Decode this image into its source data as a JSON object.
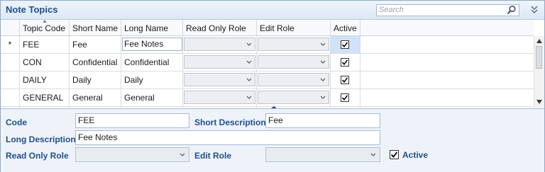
{
  "panel": {
    "title": "Note Topics",
    "search_placeholder": "Search"
  },
  "grid": {
    "columns": [
      "Topic Code",
      "Short Name",
      "Long Name",
      "Read Only Role",
      "Edit Role",
      "Active"
    ],
    "new_row_marker": "*",
    "rows": [
      {
        "code": "FEE",
        "short": "Fee",
        "long": "Fee Notes",
        "read_only_role": "",
        "edit_role": "",
        "active": true
      },
      {
        "code": "CON",
        "short": "Confidential",
        "long": "Confidential",
        "read_only_role": "",
        "edit_role": "",
        "active": true
      },
      {
        "code": "DAILY",
        "short": "Daily",
        "long": "Daily",
        "read_only_role": "",
        "edit_role": "",
        "active": true
      },
      {
        "code": "GENERAL",
        "short": "General",
        "long": "General",
        "read_only_role": "",
        "edit_role": "",
        "active": true
      }
    ]
  },
  "detail": {
    "code_label": "Code",
    "code_value": "FEE",
    "short_desc_label": "Short Description",
    "short_desc_value": "Fee",
    "long_desc_label": "Long Description",
    "long_desc_value": "Fee Notes",
    "read_only_role_label": "Read Only Role",
    "read_only_role_value": "",
    "edit_role_label": "Edit Role",
    "edit_role_value": "",
    "active_label": "Active",
    "active": true
  },
  "colors": {
    "accent": "#1f4e8c",
    "header_bg": "#dde8f5",
    "detail_bg": "#eef3fa",
    "selected_cell": "#cfe2f7"
  }
}
